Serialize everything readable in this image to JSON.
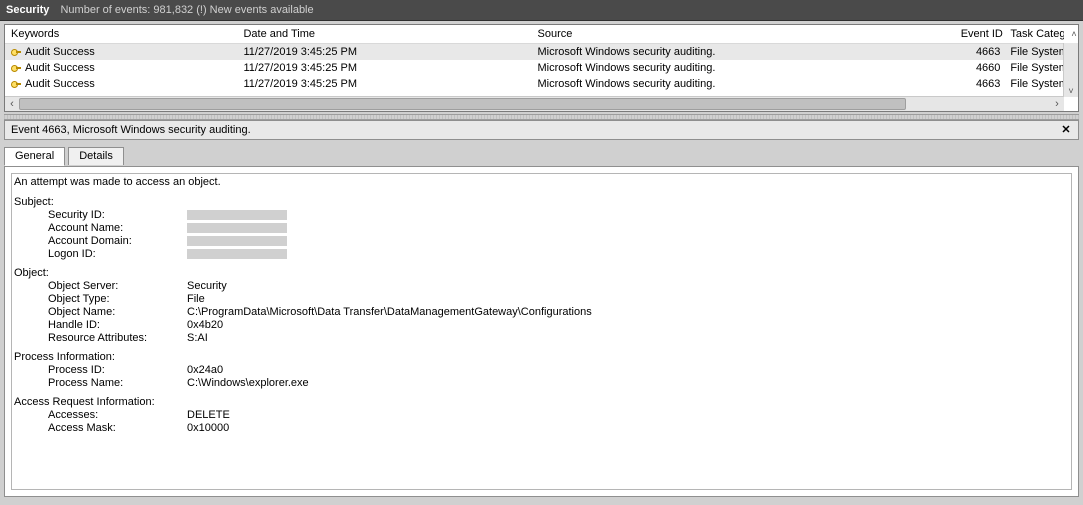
{
  "topbar": {
    "title": "Security",
    "subtitle": "Number of events: 981,832 (!) New events available"
  },
  "grid": {
    "headers": {
      "keywords": "Keywords",
      "datetime": "Date and Time",
      "source": "Source",
      "eventid": "Event ID",
      "taskcat": "Task Category"
    },
    "rows": [
      {
        "keywords": "Audit Success",
        "datetime": "11/27/2019 3:45:25 PM",
        "source": "Microsoft Windows security auditing.",
        "eventid": "4663",
        "taskcat": "File System",
        "selected": true
      },
      {
        "keywords": "Audit Success",
        "datetime": "11/27/2019 3:45:25 PM",
        "source": "Microsoft Windows security auditing.",
        "eventid": "4660",
        "taskcat": "File System",
        "selected": false
      },
      {
        "keywords": "Audit Success",
        "datetime": "11/27/2019 3:45:25 PM",
        "source": "Microsoft Windows security auditing.",
        "eventid": "4663",
        "taskcat": "File System",
        "selected": false
      }
    ]
  },
  "details": {
    "header": "Event 4663, Microsoft Windows security auditing.",
    "close": "✕",
    "tabs": {
      "general": "General",
      "details": "Details"
    },
    "general": {
      "top_line": "An attempt was made to access an object.",
      "sections": [
        {
          "title": "Subject:",
          "fields": [
            {
              "k": "Security ID:",
              "v": "[redacted]"
            },
            {
              "k": "Account Name:",
              "v": "[redacted]"
            },
            {
              "k": "Account Domain:",
              "v": "[redacted]"
            },
            {
              "k": "Logon ID:",
              "v": "[redacted]"
            }
          ]
        },
        {
          "title": "Object:",
          "fields": [
            {
              "k": "Object Server:",
              "v": "Security"
            },
            {
              "k": "Object Type:",
              "v": "File"
            },
            {
              "k": "Object Name:",
              "v": "C:\\ProgramData\\Microsoft\\Data Transfer\\DataManagementGateway\\Configurations"
            },
            {
              "k": "Handle ID:",
              "v": "0x4b20"
            },
            {
              "k": "Resource Attributes:",
              "v": "S:AI"
            }
          ]
        },
        {
          "title": "Process Information:",
          "fields": [
            {
              "k": "Process ID:",
              "v": "0x24a0"
            },
            {
              "k": "Process Name:",
              "v": "C:\\Windows\\explorer.exe"
            }
          ]
        },
        {
          "title": "Access Request Information:",
          "fields": [
            {
              "k": "Accesses:",
              "v": "DELETE"
            },
            {
              "k": "",
              "v": ""
            },
            {
              "k": "Access Mask:",
              "v": "0x10000"
            }
          ]
        }
      ]
    }
  }
}
